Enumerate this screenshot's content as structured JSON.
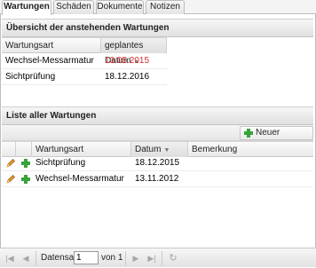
{
  "tabs": [
    {
      "label": "Wartungen",
      "active": true
    },
    {
      "label": "Schäden",
      "active": false
    },
    {
      "label": "Dokumente",
      "active": false
    },
    {
      "label": "Notizen",
      "active": false
    }
  ],
  "pending": {
    "title": "Übersicht der anstehenden Wartungen",
    "columns": [
      "Wartungsart",
      "geplantes Datum"
    ],
    "sort_column": "geplantes Datum",
    "rows": [
      {
        "type": "Wechsel-Messarmatur",
        "date": "13.05.2015",
        "overdue": true
      },
      {
        "type": "Sichtprüfung",
        "date": "18.12.2016",
        "overdue": false
      }
    ]
  },
  "all": {
    "title": "Liste aller Wartungen",
    "new_button": "Neuer Datensatz",
    "columns": [
      "Wartungsart",
      "Datum",
      "Bemerkung"
    ],
    "sort_column": "Datum",
    "rows": [
      {
        "type": "Sichtprüfung",
        "date": "18.12.2015",
        "remark": ""
      },
      {
        "type": "Wechsel-Messarmatur",
        "date": "13.11.2012",
        "remark": ""
      }
    ]
  },
  "paging": {
    "label": "Datensatz",
    "current": "1",
    "of_text": "von 1"
  },
  "colors": {
    "accent_red": "#d42d2d",
    "add_green": "#39a33c",
    "edit_orange": "#e39a2b"
  },
  "icons": {
    "edit": "pencil-icon",
    "add": "plus-icon",
    "first": "first-page-icon",
    "prev": "prev-page-icon",
    "next": "next-page-icon",
    "last": "last-page-icon",
    "refresh": "refresh-icon"
  }
}
